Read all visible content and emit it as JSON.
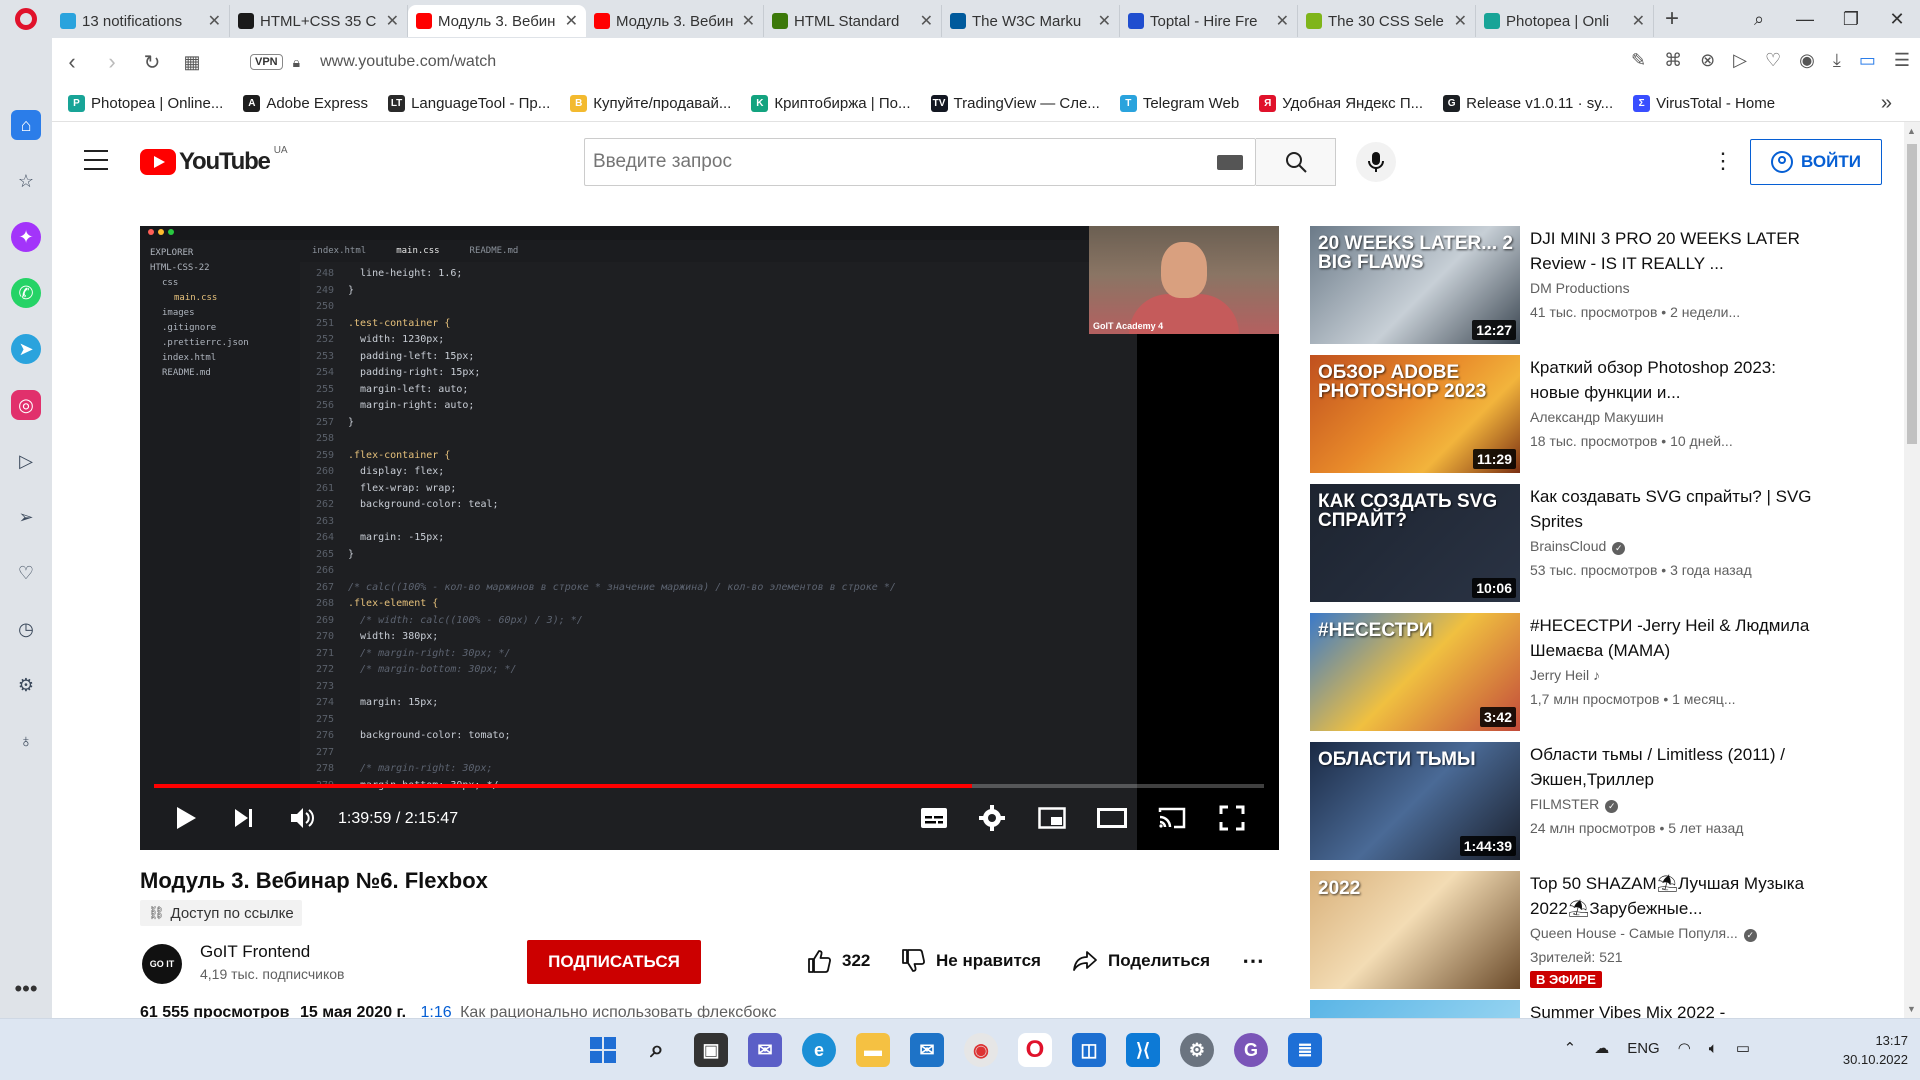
{
  "browser": {
    "tabs": [
      {
        "label": "13 notifications",
        "icon": "telegram-icon",
        "color": "#2aa3dd",
        "active": false
      },
      {
        "label": "HTML+CSS 35 C",
        "icon": "skillbox-icon",
        "color": "#1a1a1a",
        "active": false
      },
      {
        "label": "Модуль 3. Вебин",
        "icon": "youtube-icon",
        "color": "#ff0000",
        "active": true
      },
      {
        "label": "Модуль 3. Вебин",
        "icon": "youtube-icon",
        "color": "#ff0000",
        "active": false
      },
      {
        "label": "HTML Standard",
        "icon": "whatwg-icon",
        "color": "#3c790a",
        "active": false
      },
      {
        "label": "The W3C Marku",
        "icon": "w3c-icon",
        "color": "#005a9c",
        "active": false
      },
      {
        "label": "Toptal - Hire Fre",
        "icon": "toptal-icon",
        "color": "#204ecf",
        "active": false
      },
      {
        "label": "The 30 CSS Sele",
        "icon": "tutsplus-icon",
        "color": "#7fb51a",
        "active": false
      },
      {
        "label": "Photopea | Onli",
        "icon": "photopea-icon",
        "color": "#18a497",
        "active": false
      }
    ],
    "vpn_label": "VPN",
    "url": "www.youtube.com/watch",
    "bookmarks": [
      {
        "label": "Photopea | Online...",
        "color": "#18a497",
        "glyph": "P"
      },
      {
        "label": "Adobe Express",
        "color": "#1d1d1d",
        "glyph": "A"
      },
      {
        "label": "LanguageTool - Пр...",
        "color": "#2a2a2a",
        "glyph": "LT"
      },
      {
        "label": "Купуйте/продавай...",
        "color": "#f3ba2f",
        "glyph": "B"
      },
      {
        "label": "Криптобиржа | По...",
        "color": "#13a37f",
        "glyph": "K"
      },
      {
        "label": "TradingView — Сле...",
        "color": "#131722",
        "glyph": "TV"
      },
      {
        "label": "Telegram Web",
        "color": "#2aa3dd",
        "glyph": "T"
      },
      {
        "label": "Удобная Яндекс П...",
        "color": "#e0122b",
        "glyph": "Я"
      },
      {
        "label": "Release v1.0.11 · sy...",
        "color": "#1b1f23",
        "glyph": "G"
      },
      {
        "label": "VirusTotal - Home",
        "color": "#394eff",
        "glyph": "Σ"
      }
    ]
  },
  "youtube": {
    "logo_text": "YouTube",
    "country_code": "UA",
    "search_placeholder": "Введите запрос",
    "signin_label": "ВОЙТИ"
  },
  "video": {
    "current_time": "1:39:59",
    "duration": "2:15:47",
    "time_display": "1:39:59 / 2:15:47",
    "progress_fraction": 0.737,
    "title": "Модуль 3. Вебинар №6. Flexbox",
    "access": "Доступ по ссылке",
    "channel": "GoIT Frontend",
    "channel_avatar_text": "GO IT",
    "subscribers": "4,19 тыс. подписчиков",
    "subscribe_label": "ПОДПИСАТЬСЯ",
    "likes": "322",
    "dislike_label": "Не нравится",
    "share_label": "Поделиться",
    "views": "61 555 просмотров",
    "date": "15 мая 2020 г.",
    "timestamp": "1:16",
    "chapter": "Как рационально использовать флексбокс",
    "webcam_label": "GoIT Academy 4",
    "editor": {
      "explorer_items": [
        "EXPLORER",
        "HTML-CSS-22",
        "css",
        "main.css",
        "images",
        ".gitignore",
        ".prettierrc.json",
        "index.html",
        "README.md"
      ],
      "tabs": [
        "index.html",
        "main.css",
        "README.md"
      ],
      "lines": [
        {
          "n": "248",
          "t": "  line-height: 1.6;"
        },
        {
          "n": "249",
          "t": "}"
        },
        {
          "n": "250",
          "t": ""
        },
        {
          "n": "251",
          "t": ".test-container {"
        },
        {
          "n": "252",
          "t": "  width: 1230px;"
        },
        {
          "n": "253",
          "t": "  padding-left: 15px;"
        },
        {
          "n": "254",
          "t": "  padding-right: 15px;"
        },
        {
          "n": "255",
          "t": "  margin-left: auto;"
        },
        {
          "n": "256",
          "t": "  margin-right: auto;"
        },
        {
          "n": "257",
          "t": "}"
        },
        {
          "n": "258",
          "t": ""
        },
        {
          "n": "259",
          "t": ".flex-container {"
        },
        {
          "n": "260",
          "t": "  display: flex;"
        },
        {
          "n": "261",
          "t": "  flex-wrap: wrap;"
        },
        {
          "n": "262",
          "t": "  background-color: teal;"
        },
        {
          "n": "263",
          "t": ""
        },
        {
          "n": "264",
          "t": "  margin: -15px;"
        },
        {
          "n": "265",
          "t": "}"
        },
        {
          "n": "266",
          "t": ""
        },
        {
          "n": "267",
          "t": "/* calc((100% - кол-во маржинов в строке * значение маржина) / кол-во элементов в строке */"
        },
        {
          "n": "268",
          "t": ".flex-element {"
        },
        {
          "n": "269",
          "t": "  /* width: calc((100% - 60px) / 3); */"
        },
        {
          "n": "270",
          "t": "  width: 380px;"
        },
        {
          "n": "271",
          "t": "  /* margin-right: 30px; */"
        },
        {
          "n": "272",
          "t": "  /* margin-bottom: 30px; */"
        },
        {
          "n": "273",
          "t": ""
        },
        {
          "n": "274",
          "t": "  margin: 15px;"
        },
        {
          "n": "275",
          "t": ""
        },
        {
          "n": "276",
          "t": "  background-color: tomato;"
        },
        {
          "n": "277",
          "t": ""
        },
        {
          "n": "278",
          "t": "  /* margin-right: 30px;"
        },
        {
          "n": "279",
          "t": "  margin-bottom: 30px; */"
        }
      ]
    }
  },
  "related": [
    {
      "title": "DJI MINI 3 PRO 20 WEEKS LATER Review - IS IT REALLY ...",
      "channel": "DM Productions",
      "verified": false,
      "meta": "41 тыс. просмотров • 2 недели...",
      "duration": "12:27",
      "thumb_text": "20 WEEKS LATER... 2 BIG FLAWS",
      "thumb_bg": "linear-gradient(135deg,#6b7a88,#c7cfd6 55%,#3a4550)"
    },
    {
      "title": "Краткий обзор Photoshop 2023: новые функции и...",
      "channel": "Александр Макушин",
      "verified": false,
      "meta": "18 тыс. просмотров • 10 дней...",
      "duration": "11:29",
      "thumb_text": "ОБЗОР ADOBE PHOTOSHOP 2023",
      "thumb_bg": "linear-gradient(135deg,#c0501e,#e88a2a 45%,#f2b43c 70%,#7a2f12)"
    },
    {
      "title": "Как создавать SVG спрайты? | SVG Sprites",
      "channel": "BrainsCloud",
      "verified": true,
      "meta": "53 тыс. просмотров • 3 года назад",
      "duration": "10:06",
      "thumb_text": "КАК СОЗДАТЬ SVG СПРАЙТ?",
      "thumb_bg": "linear-gradient(135deg,#1d2430,#2a3344)"
    },
    {
      "title": "#НЕСЕСТРИ -Jerry Heil & Людмила Шемаєва (МАМА)",
      "channel": "Jerry Heil",
      "verified": false,
      "music": true,
      "meta": "1,7 млн просмотров • 1 месяц...",
      "duration": "3:42",
      "thumb_text": "#НЕСЕСТРИ",
      "thumb_bg": "linear-gradient(135deg,#3a79c9,#f0c040 50%,#c24a3a)"
    },
    {
      "title": "Области тьмы / Limitless (2011) / Экшен,Триллер",
      "channel": "FILMSTER",
      "verified": true,
      "meta": "24 млн просмотров • 5 лет назад",
      "duration": "1:44:39",
      "thumb_text": "ОБЛАСТИ ТЬМЫ",
      "thumb_bg": "linear-gradient(135deg,#1b2a44,#4a6a96 50%,#1a1f2b)"
    },
    {
      "title": "Top 50 SHAZAM⛱Лучшая Музыка 2022⛱Зарубежные...",
      "channel": "Queen House - Самые Популя...",
      "verified": true,
      "meta": "Зрителей: 521",
      "live": "В ЭФИРЕ",
      "duration": "",
      "thumb_text": "2022",
      "thumb_bg": "linear-gradient(135deg,#d8b07a,#f3dcb4 45%,#6a4a2a)"
    },
    {
      "title": "Summer Vibes Mix 2022 -",
      "channel": "",
      "verified": false,
      "meta": "",
      "duration": "",
      "thumb_text": "",
      "thumb_bg": "linear-gradient(135deg,#5ab5e6,#aee0f5)"
    }
  ],
  "taskbar": {
    "language": "ENG",
    "time": "13:17",
    "date": "30.10.2022"
  }
}
